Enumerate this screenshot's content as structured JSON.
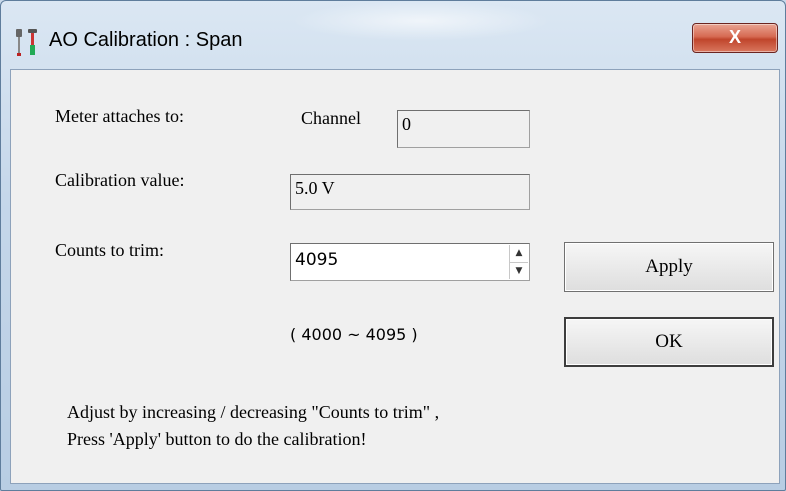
{
  "window": {
    "title": "AO Calibration : Span",
    "close_label": "X"
  },
  "meter": {
    "label": "Meter attaches to:",
    "channel_label": "Channel",
    "channel_value": "0"
  },
  "calibration": {
    "label": "Calibration value:",
    "value": "5.0 V"
  },
  "counts": {
    "label": "Counts to trim:",
    "value": "4095",
    "range": "( 4000 ~ 4095 )"
  },
  "buttons": {
    "apply": "Apply",
    "ok": "OK"
  },
  "instructions": {
    "line1": "Adjust by increasing / decreasing \"Counts to trim\" ,",
    "line2": "Press 'Apply' button to do the calibration!"
  }
}
